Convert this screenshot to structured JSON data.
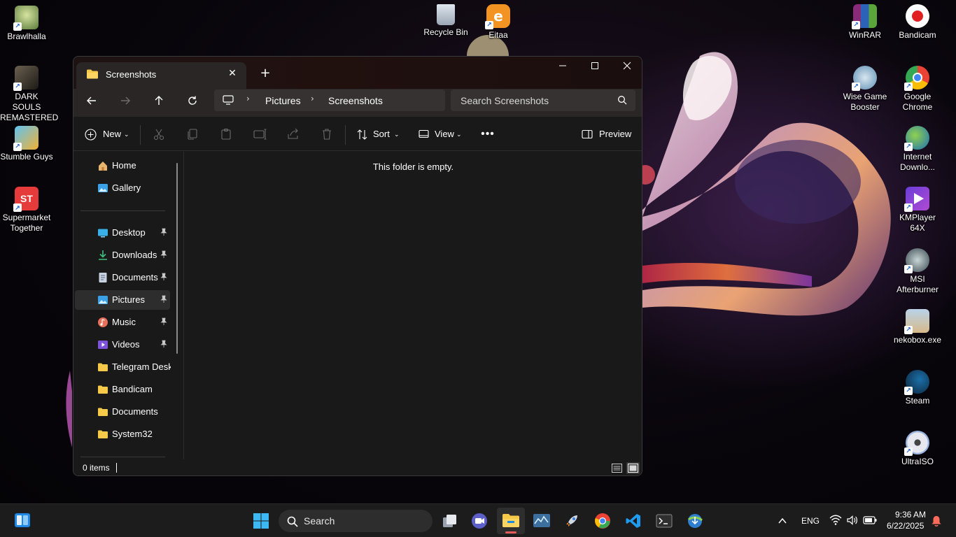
{
  "desktop": {
    "icons_left": [
      {
        "label": "Brawlhalla",
        "icon": "brawlhalla-icon"
      },
      {
        "label": "DARK SOULS REMASTERED",
        "icon": "dark-souls-icon"
      },
      {
        "label": "Stumble Guys",
        "icon": "stumble-guys-icon"
      },
      {
        "label": "Supermarket Together",
        "icon": "supermarket-together-icon"
      }
    ],
    "icons_top": [
      {
        "label": "Recycle Bin",
        "icon": "recycle-bin-icon"
      },
      {
        "label": "Eitaa",
        "icon": "eitaa-icon"
      }
    ],
    "icons_right": [
      {
        "label": "WinRAR",
        "icon": "winrar-icon"
      },
      {
        "label": "Bandicam",
        "icon": "bandicam-icon"
      },
      {
        "label": "Wise Game Booster",
        "icon": "wise-game-booster-icon"
      },
      {
        "label": "Google Chrome",
        "icon": "chrome-icon"
      },
      {
        "label": "Internet Downlo...",
        "icon": "internet-download-manager-icon"
      },
      {
        "label": "KMPlayer 64X",
        "icon": "kmplayer-icon"
      },
      {
        "label": "MSI Afterburner",
        "icon": "msi-afterburner-icon"
      },
      {
        "label": "nekobox.exe",
        "icon": "nekobox-icon"
      },
      {
        "label": "Steam",
        "icon": "steam-icon"
      },
      {
        "label": "UltraISO",
        "icon": "ultraiso-icon"
      }
    ]
  },
  "explorer": {
    "tab_title": "Screenshots",
    "address": {
      "crumbs": [
        "Pictures",
        "Screenshots"
      ]
    },
    "search_placeholder": "Search Screenshots",
    "toolbar": {
      "new_label": "New",
      "sort_label": "Sort",
      "view_label": "View",
      "preview_label": "Preview"
    },
    "sidebar": {
      "top": [
        {
          "label": "Home",
          "icon": "home-icon"
        },
        {
          "label": "Gallery",
          "icon": "gallery-icon"
        }
      ],
      "pinned": [
        {
          "label": "Desktop",
          "icon": "desktop-folder-icon"
        },
        {
          "label": "Downloads",
          "icon": "downloads-icon"
        },
        {
          "label": "Documents",
          "icon": "documents-icon"
        },
        {
          "label": "Pictures",
          "icon": "pictures-icon"
        },
        {
          "label": "Music",
          "icon": "music-icon"
        },
        {
          "label": "Videos",
          "icon": "videos-icon"
        }
      ],
      "folders": [
        {
          "label": "Telegram Desktop",
          "icon": "folder-icon"
        },
        {
          "label": "Bandicam",
          "icon": "folder-icon"
        },
        {
          "label": "Documents",
          "icon": "folder-icon"
        },
        {
          "label": "System32",
          "icon": "folder-icon"
        }
      ],
      "active": "Pictures"
    },
    "content": {
      "empty_message": "This folder is empty."
    },
    "status": {
      "item_count": "0 items"
    }
  },
  "taskbar": {
    "search_label": "Search",
    "tray": {
      "language": "ENG",
      "time": "9:36 AM",
      "date": "6/22/2025"
    }
  },
  "colors": {
    "accent": "#60cdff",
    "folder_yellow": "#f7c948",
    "bandicam_red": "#e02020",
    "active_indicator": "#e35b5b"
  }
}
